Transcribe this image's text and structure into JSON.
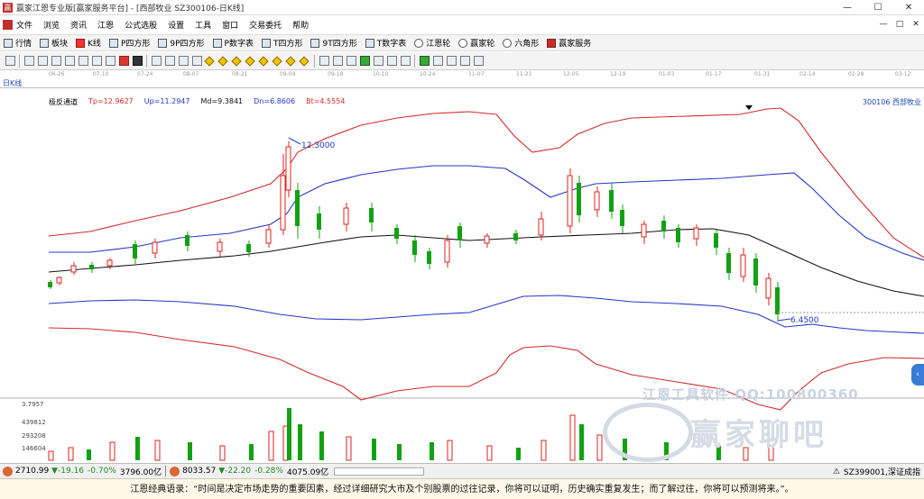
{
  "window": {
    "title": "赢家江恩专业版[赢家服务平台] - [西部牧业  SZ300106-日K线]",
    "controls": [
      "—",
      "☐",
      "✕"
    ]
  },
  "menu": {
    "items": [
      "文件",
      "浏览",
      "资讯",
      "江恩",
      "公式选股",
      "设置",
      "工具",
      "窗口",
      "交易委托",
      "帮助"
    ],
    "right": [
      "—",
      "□",
      "✕"
    ]
  },
  "toolbar": {
    "items": [
      "行情",
      "板块",
      "K线",
      "P四方形",
      "9P四方形",
      "P数字表",
      "T四方形",
      "9T四方形",
      "T数字表",
      "江恩轮",
      "赢家轮",
      "六角形",
      "赢家服务"
    ]
  },
  "chart": {
    "period": "日K线",
    "dates": [
      "06-26",
      "07-10",
      "07-24",
      "08-07",
      "08-21",
      "09-04",
      "09-18",
      "10-10",
      "10-24",
      "11-07",
      "11-21",
      "12-05",
      "12-19",
      "01-03",
      "01-17",
      "01-31",
      "02-14",
      "02-28",
      "03-12"
    ],
    "indicator": {
      "name": "极反通道",
      "tp": "Tp=12.9627",
      "up": "Up=11.2947",
      "md": "Md=9.3841",
      "dn": "Dn=6.8606",
      "bt": "Bt=4.5554"
    },
    "stock": "300106  西部牧业",
    "high_label": "12.3000",
    "low_label": "6.4500"
  },
  "volume": {
    "labels": [
      "3.7957",
      "439812",
      "293208",
      "146604"
    ]
  },
  "watermark": {
    "line1": "江恩工具软件  QQ:100800360",
    "line2": "赢家聊吧"
  },
  "status": {
    "sh_index": "2710.99",
    "sh_change": "▼-19.16",
    "sh_pct": "-0.70%",
    "sh_amount": "3796.00亿",
    "sz_index": "8033.57",
    "sz_change": "▼-22.20",
    "sz_pct": "-0.28%",
    "sz_amount": "4075.09亿",
    "right": "SZ399001,深证成指"
  },
  "quote": "江恩经典语录：“时间是决定市场走势的重要因素，经过详细研究大市及个别股票的过往记录，你将可以证明，历史确实重复发生；而了解过往，你将可以预测将来。”。",
  "colors": {
    "up": "#e0201c",
    "down": "#12a112",
    "upper_band": "#d42a2a",
    "mid_band": "#2436c8",
    "ma": "#111111"
  }
}
